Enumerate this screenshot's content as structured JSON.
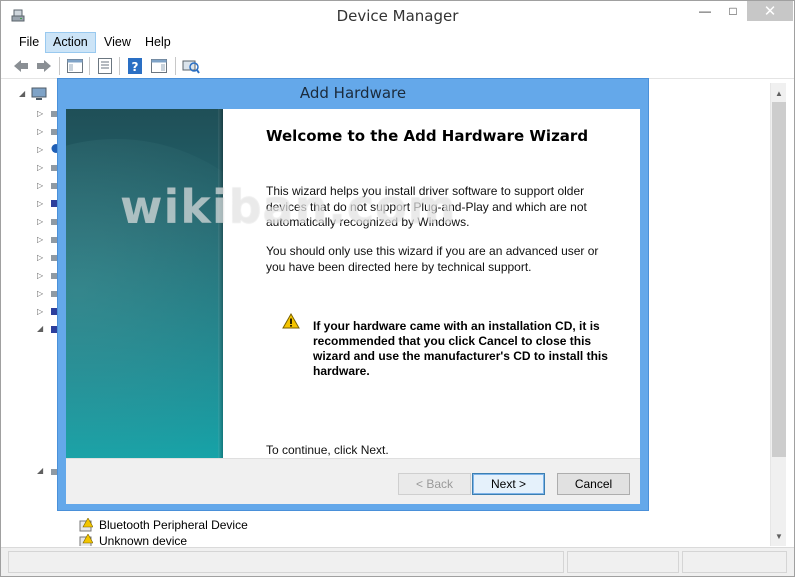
{
  "window": {
    "title": "Device Manager",
    "minimize": "—",
    "maximize": "□",
    "close": "✕"
  },
  "menu": {
    "file": "File",
    "action": "Action",
    "view": "View",
    "help": "Help"
  },
  "toolbar": {
    "buttons": [
      "back-icon",
      "forward-icon",
      "show-hide-console-tree-icon",
      "properties-icon",
      "help-icon",
      "action-pane-icon",
      "scan-hardware-icon"
    ]
  },
  "tree": {
    "visible_items": [
      {
        "label": "Bluetooth Peripheral Device",
        "icon": "device-warning-icon"
      },
      {
        "label": "Unknown device",
        "icon": "device-warning-icon"
      }
    ]
  },
  "dialog": {
    "title": "Add Hardware",
    "heading": "Welcome to the Add Hardware Wizard",
    "para1": "This wizard helps you install driver software to support older devices that do not support Plug-and-Play and which are not automatically recognized by Windows.",
    "para2": "You should only use this wizard if you are an advanced user or you have been directed here by technical support.",
    "warning": "If your hardware came with an installation CD, it is recommended that you click Cancel to close this wizard and use the manufacturer's CD to install this hardware.",
    "continue": "To continue, click Next.",
    "buttons": {
      "back": "< Back",
      "next": "Next >",
      "cancel": "Cancel"
    }
  },
  "watermark": "wikiban.com",
  "colors": {
    "dialog_frame": "#64a8ea",
    "menu_highlight": "#cce4f7",
    "banner_dark": "#1f4f57",
    "banner_light": "#15a3a8"
  }
}
